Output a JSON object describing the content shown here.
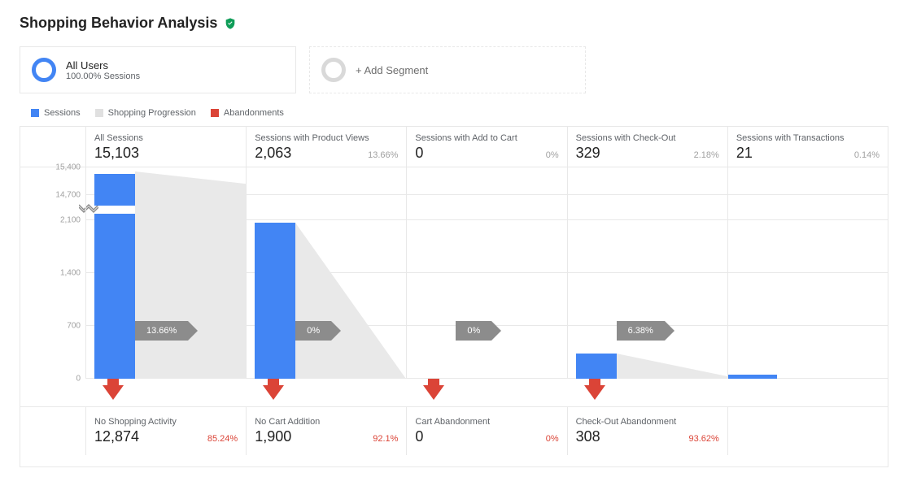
{
  "title": "Shopping Behavior Analysis",
  "segments": {
    "primary": {
      "title": "All Users",
      "sub": "100.00% Sessions"
    },
    "add": {
      "label": "+ Add Segment"
    }
  },
  "legend": {
    "sessions": "Sessions",
    "progression": "Shopping Progression",
    "abandonments": "Abandonments"
  },
  "colors": {
    "blue": "#4285f4",
    "grey": "#e5e5e5",
    "red": "#db4437"
  },
  "columns": [
    {
      "title": "All Sessions",
      "value": "15,103",
      "pct": ""
    },
    {
      "title": "Sessions with Product Views",
      "value": "2,063",
      "pct": "13.66%"
    },
    {
      "title": "Sessions with Add to Cart",
      "value": "0",
      "pct": "0%"
    },
    {
      "title": "Sessions with Check-Out",
      "value": "329",
      "pct": "2.18%"
    },
    {
      "title": "Sessions with Transactions",
      "value": "21",
      "pct": "0.14%"
    }
  ],
  "progress": [
    "13.66%",
    "0%",
    "0%",
    "6.38%"
  ],
  "abandon": [
    {
      "title": "No Shopping Activity",
      "value": "12,874",
      "pct": "85.24%"
    },
    {
      "title": "No Cart Addition",
      "value": "1,900",
      "pct": "92.1%"
    },
    {
      "title": "Cart Abandonment",
      "value": "0",
      "pct": "0%"
    },
    {
      "title": "Check-Out Abandonment",
      "value": "308",
      "pct": "93.62%"
    }
  ],
  "ticks": [
    "15,400",
    "14,700",
    "2,100",
    "1,400",
    "700",
    "0"
  ],
  "chart_data": {
    "type": "bar",
    "title": "Shopping Behavior Analysis",
    "ylabel": "Sessions",
    "ylim": [
      0,
      15400
    ],
    "axis_break": true,
    "categories": [
      "All Sessions",
      "Sessions with Product Views",
      "Sessions with Add to Cart",
      "Sessions with Check-Out",
      "Sessions with Transactions"
    ],
    "series": [
      {
        "name": "Sessions",
        "values": [
          15103,
          2063,
          0,
          329,
          21
        ]
      },
      {
        "name": "Shopping Progression %",
        "values": [
          13.66,
          0,
          0,
          6.38,
          null
        ]
      },
      {
        "name": "Abandonments",
        "labels": [
          "No Shopping Activity",
          "No Cart Addition",
          "Cart Abandonment",
          "Check-Out Abandonment"
        ],
        "values": [
          12874,
          1900,
          0,
          308
        ],
        "pct": [
          85.24,
          92.1,
          0,
          93.62
        ]
      }
    ]
  }
}
